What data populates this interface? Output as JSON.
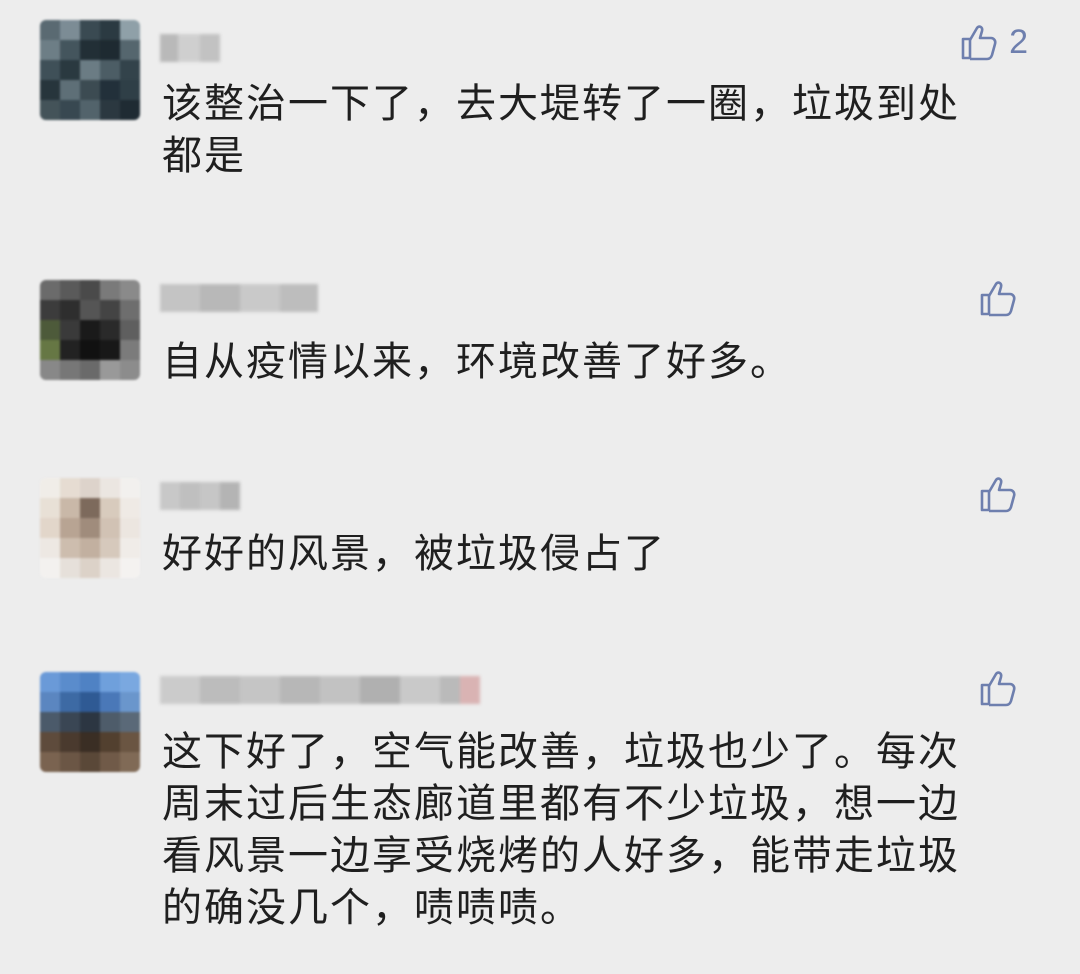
{
  "comments": [
    {
      "text": "该整治一下了，去大堤转了一圈，垃圾到处\n都是",
      "likes": "2",
      "avatar_colors": [
        "#5a6a72",
        "#7c8c95",
        "#3a4a52",
        "#2b3a42",
        "#8fa0a8",
        "#6d7e86",
        "#44555d",
        "#222f36",
        "#1e2a31",
        "#55666e",
        "#3f5058",
        "#2a3940",
        "#6b7c84",
        "#4c5d65",
        "#33434b",
        "#27353c",
        "#5e6f77",
        "#3c4b52",
        "#22303a",
        "#2f3f47",
        "#445359",
        "#384851",
        "#52636b",
        "#2b3840",
        "#1f2b33"
      ]
    },
    {
      "text": "自从疫情以来，环境改善了好多。",
      "likes": "",
      "avatar_colors": [
        "#6b6b6b",
        "#5a5a5a",
        "#4a4a4a",
        "#7a7a7a",
        "#8a8a8a",
        "#3c3c3c",
        "#2e2e2e",
        "#555555",
        "#444444",
        "#6e6e6e",
        "#4d5a3a",
        "#3a3a3a",
        "#1a1a1a",
        "#2a2a2a",
        "#5f5f5f",
        "#667744",
        "#222222",
        "#111111",
        "#181818",
        "#7b7b7b",
        "#888888",
        "#777777",
        "#6a6a6a",
        "#999999",
        "#8c8c8c"
      ]
    },
    {
      "text": "好好的风景，被垃圾侵占了",
      "likes": "",
      "avatar_colors": [
        "#f0ede8",
        "#e6dcd2",
        "#ddd3cb",
        "#ebe6e1",
        "#f2f0ee",
        "#e8e0d6",
        "#c9b8a8",
        "#7d6a5c",
        "#d8cbbd",
        "#efeae5",
        "#e2d6ca",
        "#b8a493",
        "#a08c7c",
        "#d1c2b4",
        "#ece6e0",
        "#ede8e3",
        "#cdbdae",
        "#c2b0a0",
        "#d6c9bc",
        "#f0ece8",
        "#f3f1ef",
        "#e6e0da",
        "#dcd2c8",
        "#ebe6e1",
        "#f4f2f0"
      ]
    },
    {
      "text": "这下好了，空气能改善，垃圾也少了。每次\n周末过后生态廊道里都有不少垃圾，想一边\n看风景一边享受烧烤的人好多，能带走垃圾\n的确没几个，啧啧啧。",
      "likes": "",
      "avatar_colors": [
        "#6a9ad8",
        "#5a8ccc",
        "#4f82c4",
        "#6fa0dc",
        "#7aa8e0",
        "#5b86c0",
        "#3d6aa4",
        "#2f5a94",
        "#4a78b8",
        "#6a96cc",
        "#4b5a6a",
        "#3a4654",
        "#2c3642",
        "#4e5c6a",
        "#5a6978",
        "#5e4b3c",
        "#4a3a2e",
        "#3a2e24",
        "#52402f",
        "#6a5542",
        "#7a6350",
        "#6b5645",
        "#5a4838",
        "#705a48",
        "#806a56"
      ]
    }
  ]
}
